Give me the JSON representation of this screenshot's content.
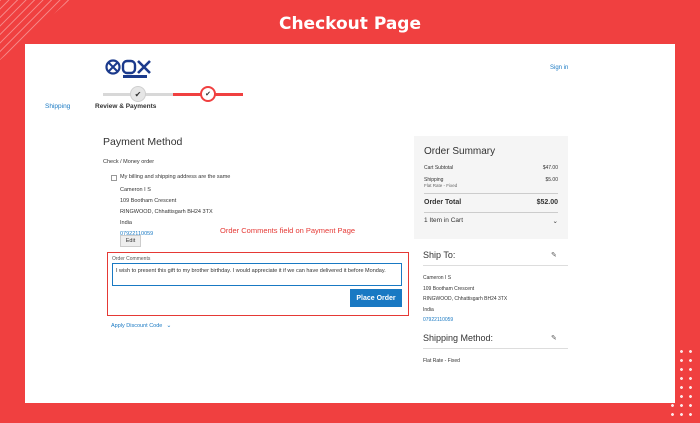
{
  "banner": {
    "title": "Checkout Page"
  },
  "header": {
    "sign_in": "Sign in"
  },
  "progress": {
    "step1_label": "Shipping",
    "step2_label": "Review & Payments",
    "check": "✔"
  },
  "payment": {
    "title": "Payment Method",
    "method": "Check / Money order",
    "same_address_label": "My billing and shipping address are the same",
    "billing_address": {
      "name": "Cameron I S",
      "street": "109 Bootham Crescent",
      "city": "RINGWOOD, Chhattisgarh BH24 3TX",
      "country": "India",
      "phone": "07922110059"
    },
    "edit_label": "Edit",
    "annotation": "Order Comments field on Payment Page",
    "comments_label": "Order Comments",
    "comments_value": "I wish to present this gift to my brother birthday. I would appreciate it if we can have delivered it before Monday.",
    "place_order_label": "Place Order",
    "discount_label": "Apply Discount Code"
  },
  "summary": {
    "title": "Order Summary",
    "cart_subtotal_label": "Cart Subtotal",
    "cart_subtotal_value": "$47.00",
    "shipping_label": "Shipping",
    "shipping_value": "$5.00",
    "shipping_method_note": "Flat Rate - Fixed",
    "order_total_label": "Order Total",
    "order_total_value": "$52.00",
    "items_in_cart": "1 Item in Cart"
  },
  "ship_to": {
    "title": "Ship To:",
    "address": {
      "name": "Cameron I S",
      "street": "109 Bootham Crescent",
      "city": "RINGWOOD, Chhattisgarh BH24 3TX",
      "country": "India",
      "phone": "07922110059"
    }
  },
  "shipping_method": {
    "title": "Shipping Method:",
    "value": "Flat Rate - Fixed"
  },
  "colors": {
    "accent": "#f04040",
    "link": "#1979c3"
  }
}
